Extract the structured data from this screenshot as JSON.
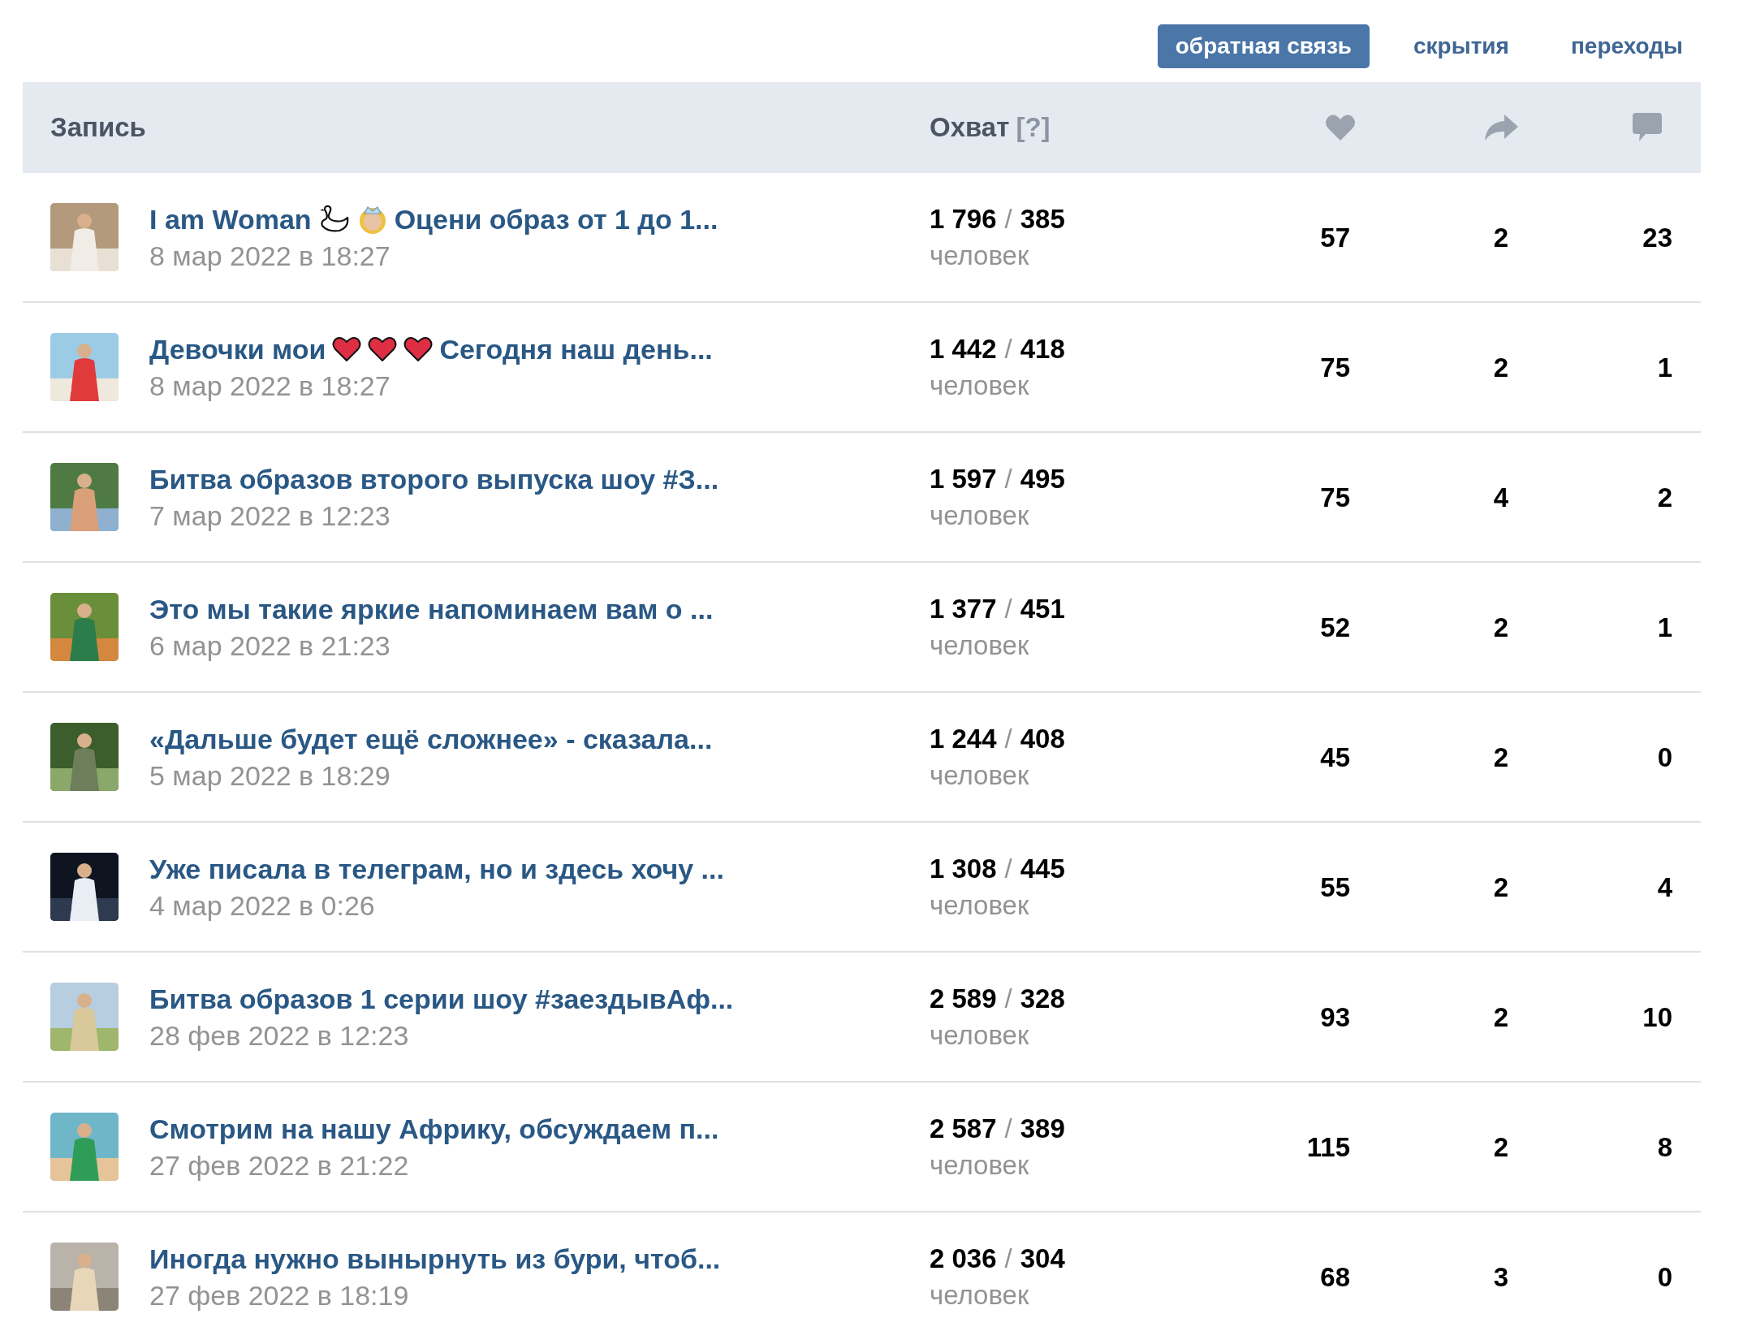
{
  "toolbar": {
    "tabs": [
      {
        "label": "обратная связь",
        "selected": true
      },
      {
        "label": "скрытия",
        "selected": false
      },
      {
        "label": "переходы",
        "selected": false
      }
    ]
  },
  "table": {
    "columns": {
      "post": "Запись",
      "reach": "Охват",
      "reach_help": "[?]"
    },
    "rows": [
      {
        "title_parts": [
          {
            "kind": "text",
            "text": "I am Woman"
          },
          {
            "kind": "swan"
          },
          {
            "kind": "princess"
          },
          {
            "kind": "text",
            "text": "Оцени образ от 1 до 1..."
          }
        ],
        "date": "8 мар 2022 в 18:27",
        "reach_total": "1 796",
        "separator": "/",
        "reach_viral": "385",
        "reach_unit": "человек",
        "likes": "57",
        "shares": "2",
        "comments": "23"
      },
      {
        "title_parts": [
          {
            "kind": "text",
            "text": "Девочки мои"
          },
          {
            "kind": "heart"
          },
          {
            "kind": "heart"
          },
          {
            "kind": "heart"
          },
          {
            "kind": "text",
            "text": "Сегодня наш день..."
          }
        ],
        "date": "8 мар 2022 в 18:27",
        "reach_total": "1 442",
        "separator": "/",
        "reach_viral": "418",
        "reach_unit": "человек",
        "likes": "75",
        "shares": "2",
        "comments": "1"
      },
      {
        "title_parts": [
          {
            "kind": "text",
            "text": "Битва образов второго выпуска шоу #З..."
          }
        ],
        "date": "7 мар 2022 в 12:23",
        "reach_total": "1 597",
        "separator": "/",
        "reach_viral": "495",
        "reach_unit": "человек",
        "likes": "75",
        "shares": "4",
        "comments": "2"
      },
      {
        "title_parts": [
          {
            "kind": "text",
            "text": "Это мы такие яркие напоминаем вам о ..."
          }
        ],
        "date": "6 мар 2022 в 21:23",
        "reach_total": "1 377",
        "separator": "/",
        "reach_viral": "451",
        "reach_unit": "человек",
        "likes": "52",
        "shares": "2",
        "comments": "1"
      },
      {
        "title_parts": [
          {
            "kind": "text",
            "text": "«Дальше будет ещё сложнее» - сказала..."
          }
        ],
        "date": "5 мар 2022 в 18:29",
        "reach_total": "1 244",
        "separator": "/",
        "reach_viral": "408",
        "reach_unit": "человек",
        "likes": "45",
        "shares": "2",
        "comments": "0"
      },
      {
        "title_parts": [
          {
            "kind": "text",
            "text": "Уже писала в телеграм, но и здесь хочу ..."
          }
        ],
        "date": "4 мар 2022 в 0:26",
        "reach_total": "1 308",
        "separator": "/",
        "reach_viral": "445",
        "reach_unit": "человек",
        "likes": "55",
        "shares": "2",
        "comments": "4"
      },
      {
        "title_parts": [
          {
            "kind": "text",
            "text": "Битва образов 1 серии шоу #заездывАф..."
          }
        ],
        "date": "28 фев 2022 в 12:23",
        "reach_total": "2 589",
        "separator": "/",
        "reach_viral": "328",
        "reach_unit": "человек",
        "likes": "93",
        "shares": "2",
        "comments": "10"
      },
      {
        "title_parts": [
          {
            "kind": "text",
            "text": "Смотрим на нашу Африку, обсуждаем п..."
          }
        ],
        "date": "27 фев 2022 в 21:22",
        "reach_total": "2 587",
        "separator": "/",
        "reach_viral": "389",
        "reach_unit": "человек",
        "likes": "115",
        "shares": "2",
        "comments": "8"
      },
      {
        "title_parts": [
          {
            "kind": "text",
            "text": "Иногда нужно вынырнуть из бури, чтоб..."
          }
        ],
        "date": "27 фев 2022 в 18:19",
        "reach_total": "2 036",
        "separator": "/",
        "reach_viral": "304",
        "reach_unit": "человек",
        "likes": "68",
        "shares": "3",
        "comments": "0"
      }
    ]
  }
}
